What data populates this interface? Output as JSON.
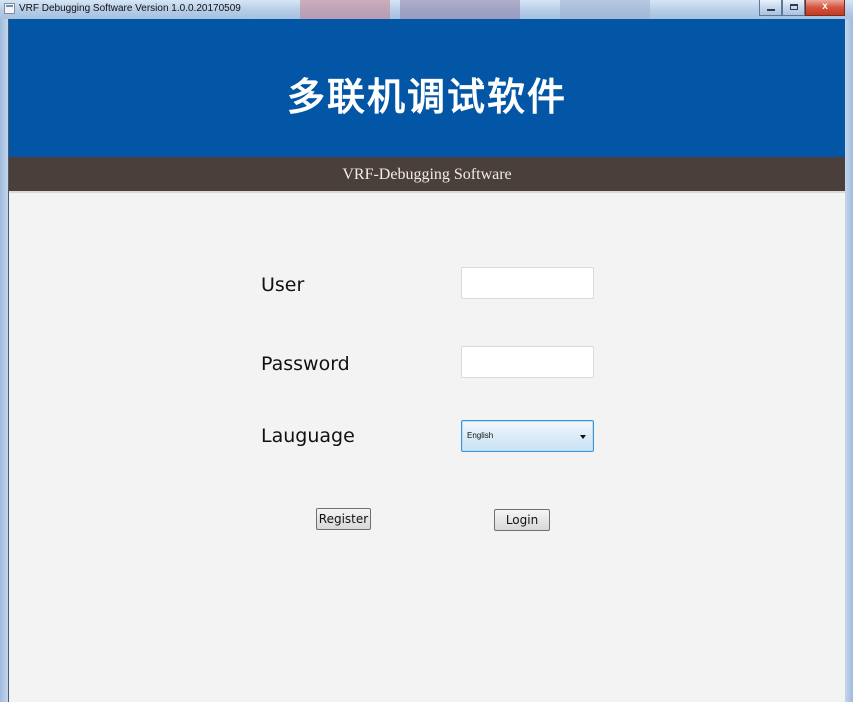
{
  "window": {
    "title": "VRF Debugging Software Version 1.0.0.20170509",
    "minimize_glyph": "_",
    "maximize_glyph": "□",
    "close_glyph": "x"
  },
  "header": {
    "title_cn": "多联机调试软件",
    "title_en": "VRF-Debugging Software"
  },
  "form": {
    "user_label": "User",
    "user_value": "",
    "password_label": "Password",
    "password_value": "",
    "language_label": "Lauguage",
    "language_selected": "English",
    "register_label": "Register",
    "login_label": "Login"
  },
  "colors": {
    "banner": "#0356a5",
    "subbanner": "#4a3f3b",
    "background": "#f3f3f3"
  }
}
